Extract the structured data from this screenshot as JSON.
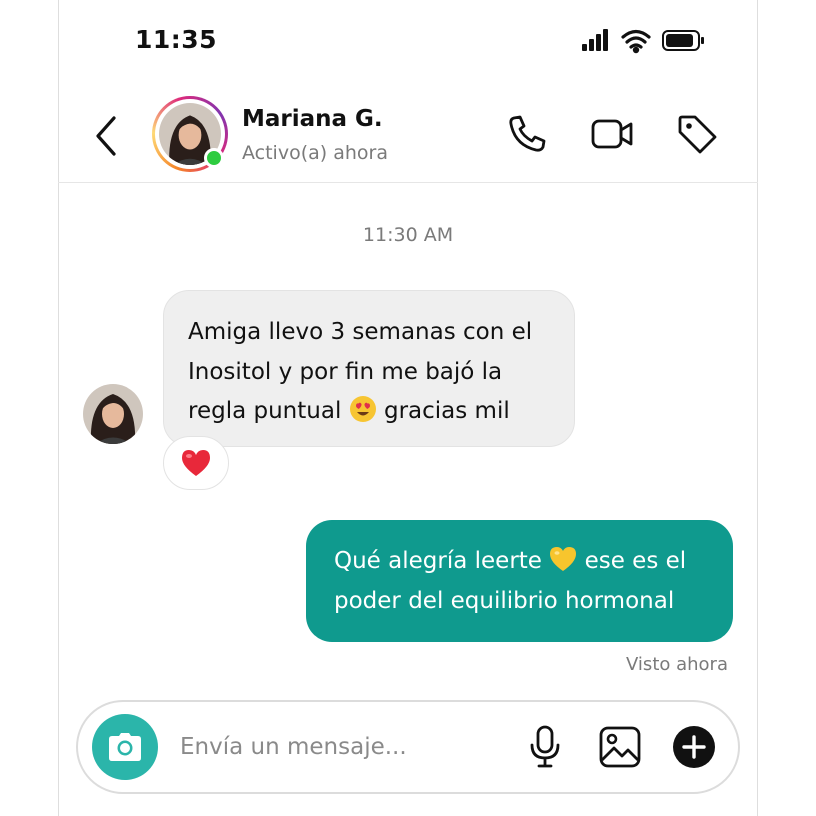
{
  "status_bar": {
    "time": "11:35",
    "icons": [
      "signal-icon",
      "wifi-icon",
      "battery-icon"
    ]
  },
  "header": {
    "contact_name": "Mariana G.",
    "contact_status": "Activo(a) ahora",
    "online": true,
    "icons": [
      "back-icon",
      "phone-icon",
      "video-icon",
      "tag-icon"
    ]
  },
  "chat": {
    "timestamp": "11:30 AM",
    "incoming": {
      "line1": "Amiga llevo 3 semanas con el",
      "line2": "Inositol y por fin me bajó la",
      "line3_before": "regla puntual",
      "line3_emoji": "heart-eyes-emoji",
      "line3_after": "gracias mil",
      "reaction": "red-heart-emoji"
    },
    "outgoing": {
      "line1_before": "Qué alegría leerte",
      "line1_emoji": "yellow-heart-emoji",
      "line1_after": "ese es el",
      "line2": "poder del equilibrio hormonal"
    },
    "seen_label": "Visto ahora"
  },
  "composer": {
    "placeholder": "Envía un mensaje...",
    "icons": [
      "camera-icon",
      "microphone-icon",
      "gallery-icon",
      "plus-icon"
    ]
  },
  "colors": {
    "outgoing_bubble": "#0f9a8e",
    "camera_button": "#2bb5aa",
    "incoming_bubble": "#efefef",
    "online_dot": "#2ecc40"
  }
}
